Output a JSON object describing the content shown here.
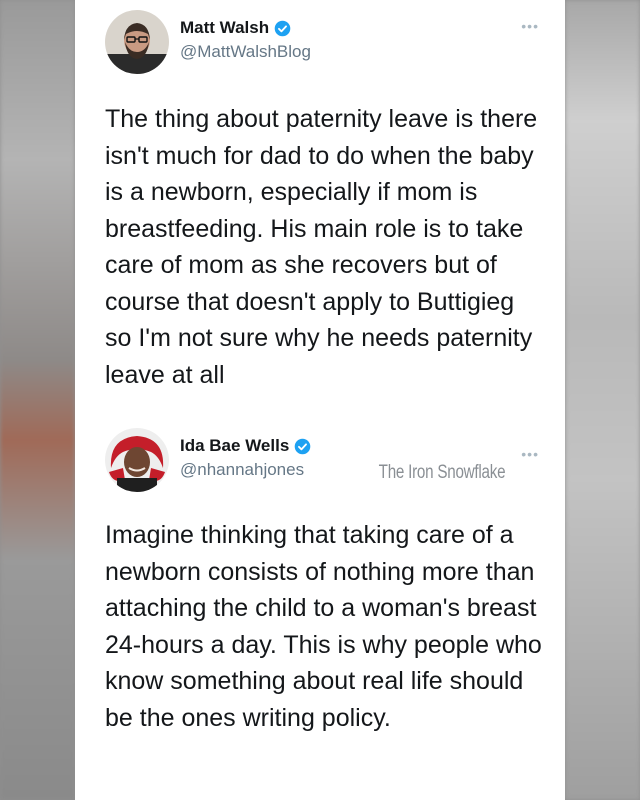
{
  "tweet1": {
    "display_name": "Matt Walsh",
    "handle": "@MattWalshBlog",
    "text": "The thing about paternity leave is there isn't much for dad to do when the baby is a newborn, especially if mom is breastfeeding. His main role is to take care of mom as she recovers but of course that doesn't apply to Buttigieg so I'm not sure why he needs paternity leave at all",
    "verified_icon": "verified-badge",
    "more_icon": "more-dots"
  },
  "tweet2": {
    "display_name": "Ida Bae Wells",
    "handle": "@nhannahjones",
    "text": "Imagine thinking that taking care of a newborn consists of nothing more than attaching the child to a woman's breast 24-hours a day. This is why people who know something about real life should be the ones writing policy.",
    "verified_icon": "verified-badge",
    "more_icon": "more-dots"
  },
  "watermark": "The Iron Snowflake",
  "colors": {
    "verified": "#1da1f2",
    "text": "#14171a",
    "handle": "#657786"
  }
}
